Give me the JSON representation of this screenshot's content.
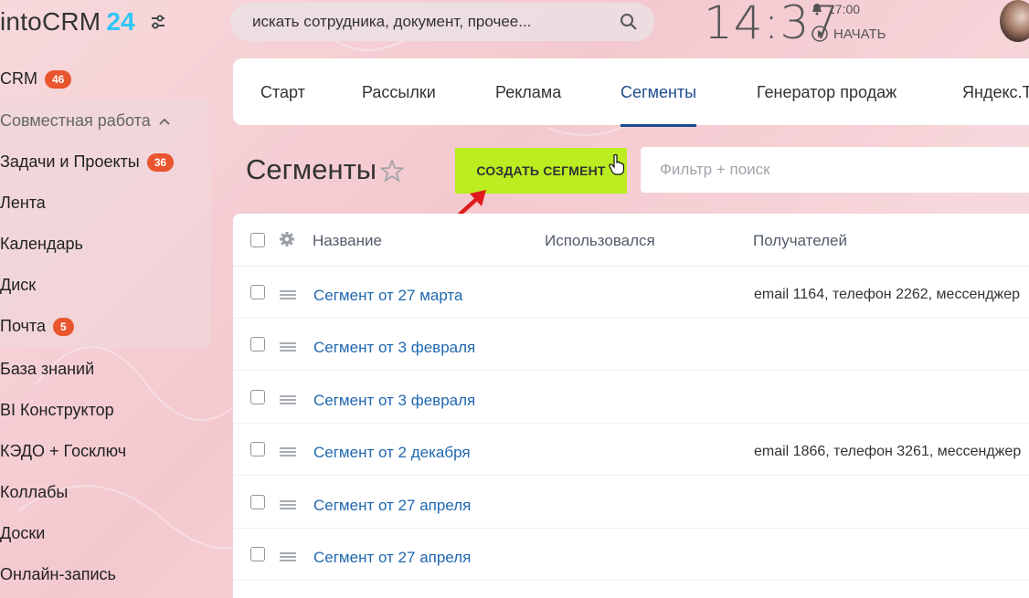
{
  "app": {
    "logo_text": "intoCRM",
    "logo_num": "24"
  },
  "search": {
    "placeholder": "искать сотрудника, документ, прочее..."
  },
  "clock": {
    "time": "14:37",
    "alarm": "17:00",
    "start_label": "НАЧАТЬ"
  },
  "sidebar": {
    "items": [
      {
        "label": "CRM",
        "badge": "46"
      },
      {
        "label": "Совместная работа",
        "badge": ""
      },
      {
        "label": "Задачи и Проекты",
        "badge": "36"
      },
      {
        "label": "Лента",
        "badge": ""
      },
      {
        "label": "Календарь",
        "badge": ""
      },
      {
        "label": "Диск",
        "badge": ""
      },
      {
        "label": "Почта",
        "badge": "5"
      },
      {
        "label": "База знаний",
        "badge": ""
      },
      {
        "label": "BI Конструктор",
        "badge": ""
      },
      {
        "label": "КЭДО + Госключ",
        "badge": ""
      },
      {
        "label": "Коллабы",
        "badge": ""
      },
      {
        "label": "Доски",
        "badge": ""
      },
      {
        "label": "Онлайн-запись",
        "badge": ""
      }
    ]
  },
  "tabs": [
    {
      "label": "Старт"
    },
    {
      "label": "Рассылки"
    },
    {
      "label": "Реклама"
    },
    {
      "label": "Сегменты"
    },
    {
      "label": "Генератор продаж"
    },
    {
      "label": "Яндекс.Т"
    }
  ],
  "page": {
    "title": "Сегменты",
    "create_button": "СОЗДАТЬ СЕГМЕНТ",
    "filter_placeholder": "Фильтр + поиск"
  },
  "table": {
    "columns": [
      "Название",
      "Использовался",
      "Получателей"
    ],
    "rows": [
      {
        "name": "Сегмент от 27 марта",
        "used": "",
        "recipients": "email 1164, телефон 2262, мессенджер"
      },
      {
        "name": "Сегмент от 3 февраля",
        "used": "",
        "recipients": ""
      },
      {
        "name": "Сегмент от 3 февраля",
        "used": "",
        "recipients": ""
      },
      {
        "name": "Сегмент от 2 декабря",
        "used": "",
        "recipients": "email 1866, телефон 3261, мессенджер"
      },
      {
        "name": "Сегмент от 27 апреля",
        "used": "",
        "recipients": ""
      },
      {
        "name": "Сегмент от 27 апреля",
        "used": "",
        "recipients": ""
      }
    ]
  },
  "colors": {
    "accent": "#1d4b8c",
    "badge": "#e9552d",
    "create_button": "#bbed21",
    "link": "#2067b0",
    "arrow": "#e01b1b"
  }
}
